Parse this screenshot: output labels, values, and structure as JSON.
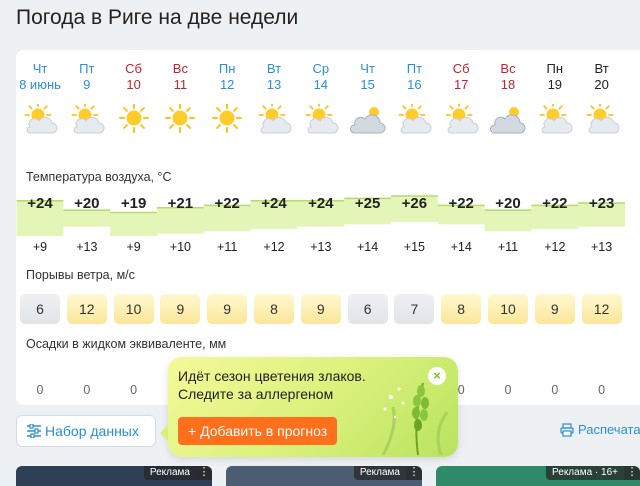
{
  "page": {
    "title": "Погода в Риге на две недели"
  },
  "days": [
    {
      "dow": "Чт",
      "date": "8 июнь",
      "dow_color": "#2a8fd6",
      "icon": "partly-sunny-icon",
      "tmax": "+24",
      "tmin": "+9",
      "gust": "6",
      "gust_style": "gray",
      "precip": "0"
    },
    {
      "dow": "Пт",
      "date": "9",
      "dow_color": "#2a8fd6",
      "icon": "partly-sunny-icon",
      "tmax": "+20",
      "tmin": "+13",
      "gust": "12",
      "gust_style": "yellow",
      "precip": "0"
    },
    {
      "dow": "Сб",
      "date": "10",
      "dow_color": "#c4232d",
      "icon": "sun-icon",
      "tmax": "+19",
      "tmin": "+9",
      "gust": "10",
      "gust_style": "yellow",
      "precip": "0"
    },
    {
      "dow": "Вс",
      "date": "11",
      "dow_color": "#c4232d",
      "icon": "sun-icon",
      "tmax": "+21",
      "tmin": "+10",
      "gust": "9",
      "gust_style": "yellow",
      "precip": "0"
    },
    {
      "dow": "Пн",
      "date": "12",
      "dow_color": "#2a8fd6",
      "icon": "sun-icon",
      "tmax": "+22",
      "tmin": "+11",
      "gust": "9",
      "gust_style": "yellow",
      "precip": "0"
    },
    {
      "dow": "Вт",
      "date": "13",
      "dow_color": "#2a8fd6",
      "icon": "partly-sunny-icon",
      "tmax": "+24",
      "tmin": "+12",
      "gust": "8",
      "gust_style": "yellow",
      "precip": "0"
    },
    {
      "dow": "Ср",
      "date": "14",
      "dow_color": "#2a8fd6",
      "icon": "partly-sunny-icon",
      "tmax": "+24",
      "tmin": "+13",
      "gust": "9",
      "gust_style": "yellow",
      "precip": "0"
    },
    {
      "dow": "Чт",
      "date": "15",
      "dow_color": "#2a8fd6",
      "icon": "cloudy-icon",
      "tmax": "+25",
      "tmin": "+14",
      "gust": "6",
      "gust_style": "gray",
      "precip": "0"
    },
    {
      "dow": "Пт",
      "date": "16",
      "dow_color": "#2a8fd6",
      "icon": "partly-sunny-icon",
      "tmax": "+26",
      "tmin": "+15",
      "gust": "7",
      "gust_style": "gray",
      "precip": "0"
    },
    {
      "dow": "Сб",
      "date": "17",
      "dow_color": "#c4232d",
      "icon": "partly-sunny-icon",
      "tmax": "+22",
      "tmin": "+14",
      "gust": "8",
      "gust_style": "yellow",
      "precip": "0"
    },
    {
      "dow": "Вс",
      "date": "18",
      "dow_color": "#c4232d",
      "icon": "cloudy-icon",
      "tmax": "+20",
      "tmin": "+11",
      "gust": "10",
      "gust_style": "yellow",
      "precip": "0"
    },
    {
      "dow": "Пн",
      "date": "19",
      "dow_color": "#222222",
      "icon": "partly-sunny-icon",
      "tmax": "+22",
      "tmin": "+12",
      "gust": "9",
      "gust_style": "yellow",
      "precip": "0"
    },
    {
      "dow": "Вт",
      "date": "20",
      "dow_color": "#222222",
      "icon": "partly-sunny-icon",
      "tmax": "+23",
      "tmin": "+13",
      "gust": "12",
      "gust_style": "yellow",
      "precip": "0"
    }
  ],
  "sections": {
    "temperature": "Температура воздуха, °C",
    "wind": "Порывы ветра, м/с",
    "precip": "Осадки в жидком эквиваленте, мм"
  },
  "popup": {
    "text": "Идёт сезон цветения злаков. Следите за аллергеном",
    "close": "×",
    "button": "+ Добавить в прогноз"
  },
  "controls": {
    "filter_button": "Набор данных",
    "print_link": "Распечатать"
  },
  "ads": [
    {
      "tag": "Реклама",
      "more": "⋮"
    },
    {
      "tag": "Реклама",
      "more": "⋮"
    },
    {
      "tag": "Реклама · 16+",
      "more": "⋮"
    }
  ],
  "colors": {
    "accent_blue": "#2a8fd6",
    "weekend_red": "#c4232d",
    "orange_button": "#ff6f1c",
    "temp_band": "#e4f5b8"
  }
}
